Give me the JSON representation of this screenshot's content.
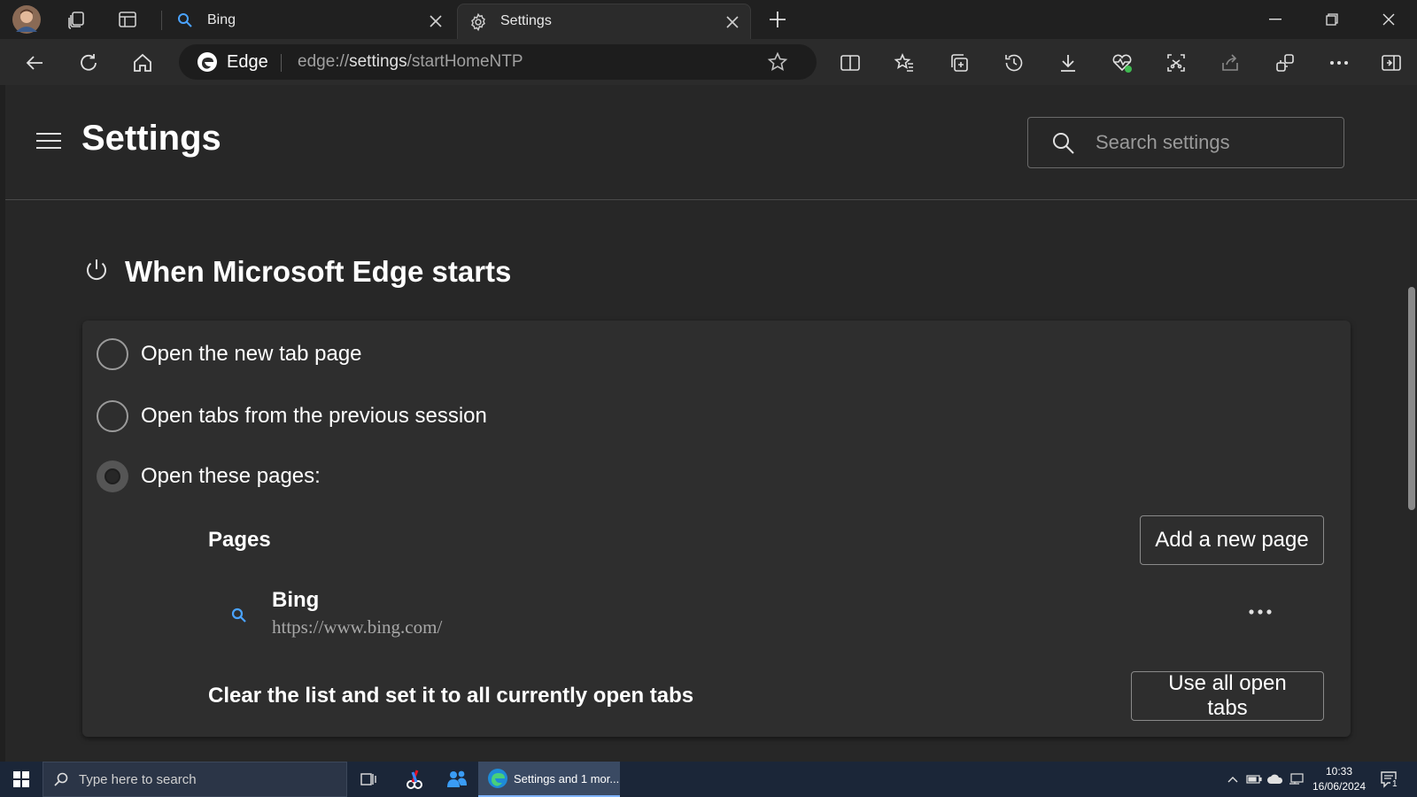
{
  "browser": {
    "tabs": [
      {
        "title": "Bing",
        "active": false
      },
      {
        "title": "Settings",
        "active": true
      }
    ],
    "site_name": "Edge",
    "url": {
      "scheme": "edge://",
      "host": "settings",
      "path": "/startHomeNTP"
    }
  },
  "settings": {
    "title": "Settings",
    "search_placeholder": "Search settings",
    "section_title": "When Microsoft Edge starts",
    "options": [
      {
        "label": "Open the new tab page",
        "selected": false
      },
      {
        "label": "Open tabs from the previous session",
        "selected": false
      },
      {
        "label": "Open these pages:",
        "selected": true
      }
    ],
    "pages_label": "Pages",
    "add_page_label": "Add a new page",
    "pages": [
      {
        "title": "Bing",
        "url": "https://www.bing.com/"
      }
    ],
    "clear_text": "Clear the list and set it to all currently open tabs",
    "use_all_label": "Use all open tabs"
  },
  "taskbar": {
    "search_placeholder": "Type here to search",
    "edge_label": "Settings and 1 mor...",
    "time": "10:33",
    "date": "16/06/2024",
    "notification_count": "1"
  },
  "colors": {
    "accent": "#4aa3ff",
    "background": "#202020",
    "card": "#2e2e2e",
    "taskbar": "#1b2638"
  }
}
